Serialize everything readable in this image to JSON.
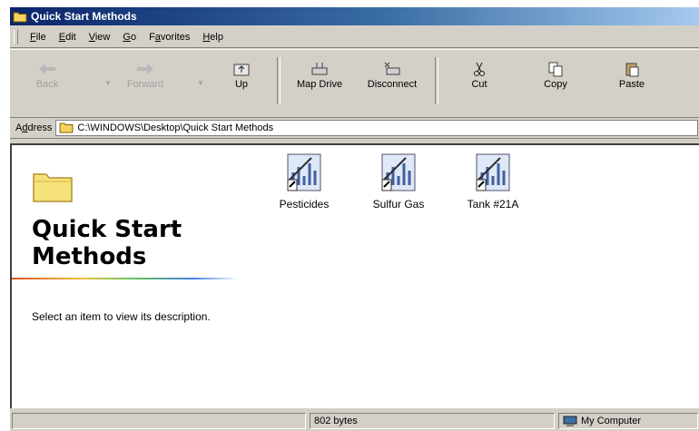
{
  "window": {
    "title": "Quick Start Methods"
  },
  "menu": [
    {
      "pre": "",
      "u": "F",
      "post": "ile"
    },
    {
      "pre": "",
      "u": "E",
      "post": "dit"
    },
    {
      "pre": "",
      "u": "V",
      "post": "iew"
    },
    {
      "pre": "",
      "u": "G",
      "post": "o"
    },
    {
      "pre": "F",
      "u": "a",
      "post": "vorites"
    },
    {
      "pre": "",
      "u": "H",
      "post": "elp"
    }
  ],
  "toolbar": {
    "back": "Back",
    "forward": "Forward",
    "up": "Up",
    "map_drive": "Map Drive",
    "disconnect": "Disconnect",
    "cut": "Cut",
    "copy": "Copy",
    "paste": "Paste"
  },
  "address": {
    "label_pre": "A",
    "label_u": "d",
    "label_post": "dress",
    "path": "C:\\WINDOWS\\Desktop\\Quick Start Methods"
  },
  "left_pane": {
    "title_line1": "Quick Start",
    "title_line2": "Methods",
    "description": "Select an item to view its description."
  },
  "files": [
    {
      "name": "Pesticides"
    },
    {
      "name": "Sulfur Gas"
    },
    {
      "name": "Tank #21A"
    }
  ],
  "status": {
    "size": "802 bytes",
    "zone": "My Computer"
  },
  "icons": {
    "title": "folder-icon",
    "file": "method-file-icon"
  }
}
